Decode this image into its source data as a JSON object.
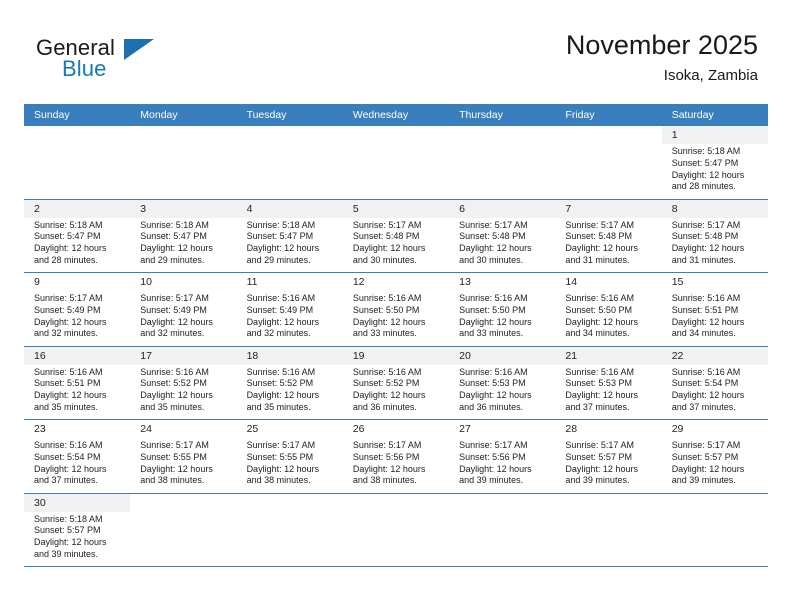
{
  "brand": {
    "name_primary": "General",
    "name_secondary": "Blue",
    "flag_icon": "blue-triangle-flag-icon",
    "accent_color": "#1878be"
  },
  "header": {
    "title": "November 2025",
    "subtitle": "Isoka, Zambia",
    "header_bg_color": "#3a7fbd"
  },
  "weekdays": [
    "Sunday",
    "Monday",
    "Tuesday",
    "Wednesday",
    "Thursday",
    "Friday",
    "Saturday"
  ],
  "labels": {
    "sunrise_prefix": "Sunrise:",
    "sunset_prefix": "Sunset:",
    "daylight_prefix": "Daylight:"
  },
  "weeks": [
    {
      "shaded": true,
      "days": [
        {
          "empty": true
        },
        {
          "empty": true
        },
        {
          "empty": true
        },
        {
          "empty": true
        },
        {
          "empty": true
        },
        {
          "empty": true
        },
        {
          "date": "1",
          "sunrise": "Sunrise: 5:18 AM",
          "sunset": "Sunset: 5:47 PM",
          "daylight_line1": "Daylight: 12 hours",
          "daylight_line2": "and 28 minutes."
        }
      ]
    },
    {
      "shaded": true,
      "days": [
        {
          "date": "2",
          "sunrise": "Sunrise: 5:18 AM",
          "sunset": "Sunset: 5:47 PM",
          "daylight_line1": "Daylight: 12 hours",
          "daylight_line2": "and 28 minutes."
        },
        {
          "date": "3",
          "sunrise": "Sunrise: 5:18 AM",
          "sunset": "Sunset: 5:47 PM",
          "daylight_line1": "Daylight: 12 hours",
          "daylight_line2": "and 29 minutes."
        },
        {
          "date": "4",
          "sunrise": "Sunrise: 5:18 AM",
          "sunset": "Sunset: 5:47 PM",
          "daylight_line1": "Daylight: 12 hours",
          "daylight_line2": "and 29 minutes."
        },
        {
          "date": "5",
          "sunrise": "Sunrise: 5:17 AM",
          "sunset": "Sunset: 5:48 PM",
          "daylight_line1": "Daylight: 12 hours",
          "daylight_line2": "and 30 minutes."
        },
        {
          "date": "6",
          "sunrise": "Sunrise: 5:17 AM",
          "sunset": "Sunset: 5:48 PM",
          "daylight_line1": "Daylight: 12 hours",
          "daylight_line2": "and 30 minutes."
        },
        {
          "date": "7",
          "sunrise": "Sunrise: 5:17 AM",
          "sunset": "Sunset: 5:48 PM",
          "daylight_line1": "Daylight: 12 hours",
          "daylight_line2": "and 31 minutes."
        },
        {
          "date": "8",
          "sunrise": "Sunrise: 5:17 AM",
          "sunset": "Sunset: 5:48 PM",
          "daylight_line1": "Daylight: 12 hours",
          "daylight_line2": "and 31 minutes."
        }
      ]
    },
    {
      "shaded": false,
      "days": [
        {
          "date": "9",
          "sunrise": "Sunrise: 5:17 AM",
          "sunset": "Sunset: 5:49 PM",
          "daylight_line1": "Daylight: 12 hours",
          "daylight_line2": "and 32 minutes."
        },
        {
          "date": "10",
          "sunrise": "Sunrise: 5:17 AM",
          "sunset": "Sunset: 5:49 PM",
          "daylight_line1": "Daylight: 12 hours",
          "daylight_line2": "and 32 minutes."
        },
        {
          "date": "11",
          "sunrise": "Sunrise: 5:16 AM",
          "sunset": "Sunset: 5:49 PM",
          "daylight_line1": "Daylight: 12 hours",
          "daylight_line2": "and 32 minutes."
        },
        {
          "date": "12",
          "sunrise": "Sunrise: 5:16 AM",
          "sunset": "Sunset: 5:50 PM",
          "daylight_line1": "Daylight: 12 hours",
          "daylight_line2": "and 33 minutes."
        },
        {
          "date": "13",
          "sunrise": "Sunrise: 5:16 AM",
          "sunset": "Sunset: 5:50 PM",
          "daylight_line1": "Daylight: 12 hours",
          "daylight_line2": "and 33 minutes."
        },
        {
          "date": "14",
          "sunrise": "Sunrise: 5:16 AM",
          "sunset": "Sunset: 5:50 PM",
          "daylight_line1": "Daylight: 12 hours",
          "daylight_line2": "and 34 minutes."
        },
        {
          "date": "15",
          "sunrise": "Sunrise: 5:16 AM",
          "sunset": "Sunset: 5:51 PM",
          "daylight_line1": "Daylight: 12 hours",
          "daylight_line2": "and 34 minutes."
        }
      ]
    },
    {
      "shaded": true,
      "days": [
        {
          "date": "16",
          "sunrise": "Sunrise: 5:16 AM",
          "sunset": "Sunset: 5:51 PM",
          "daylight_line1": "Daylight: 12 hours",
          "daylight_line2": "and 35 minutes."
        },
        {
          "date": "17",
          "sunrise": "Sunrise: 5:16 AM",
          "sunset": "Sunset: 5:52 PM",
          "daylight_line1": "Daylight: 12 hours",
          "daylight_line2": "and 35 minutes."
        },
        {
          "date": "18",
          "sunrise": "Sunrise: 5:16 AM",
          "sunset": "Sunset: 5:52 PM",
          "daylight_line1": "Daylight: 12 hours",
          "daylight_line2": "and 35 minutes."
        },
        {
          "date": "19",
          "sunrise": "Sunrise: 5:16 AM",
          "sunset": "Sunset: 5:52 PM",
          "daylight_line1": "Daylight: 12 hours",
          "daylight_line2": "and 36 minutes."
        },
        {
          "date": "20",
          "sunrise": "Sunrise: 5:16 AM",
          "sunset": "Sunset: 5:53 PM",
          "daylight_line1": "Daylight: 12 hours",
          "daylight_line2": "and 36 minutes."
        },
        {
          "date": "21",
          "sunrise": "Sunrise: 5:16 AM",
          "sunset": "Sunset: 5:53 PM",
          "daylight_line1": "Daylight: 12 hours",
          "daylight_line2": "and 37 minutes."
        },
        {
          "date": "22",
          "sunrise": "Sunrise: 5:16 AM",
          "sunset": "Sunset: 5:54 PM",
          "daylight_line1": "Daylight: 12 hours",
          "daylight_line2": "and 37 minutes."
        }
      ]
    },
    {
      "shaded": false,
      "days": [
        {
          "date": "23",
          "sunrise": "Sunrise: 5:16 AM",
          "sunset": "Sunset: 5:54 PM",
          "daylight_line1": "Daylight: 12 hours",
          "daylight_line2": "and 37 minutes."
        },
        {
          "date": "24",
          "sunrise": "Sunrise: 5:17 AM",
          "sunset": "Sunset: 5:55 PM",
          "daylight_line1": "Daylight: 12 hours",
          "daylight_line2": "and 38 minutes."
        },
        {
          "date": "25",
          "sunrise": "Sunrise: 5:17 AM",
          "sunset": "Sunset: 5:55 PM",
          "daylight_line1": "Daylight: 12 hours",
          "daylight_line2": "and 38 minutes."
        },
        {
          "date": "26",
          "sunrise": "Sunrise: 5:17 AM",
          "sunset": "Sunset: 5:56 PM",
          "daylight_line1": "Daylight: 12 hours",
          "daylight_line2": "and 38 minutes."
        },
        {
          "date": "27",
          "sunrise": "Sunrise: 5:17 AM",
          "sunset": "Sunset: 5:56 PM",
          "daylight_line1": "Daylight: 12 hours",
          "daylight_line2": "and 39 minutes."
        },
        {
          "date": "28",
          "sunrise": "Sunrise: 5:17 AM",
          "sunset": "Sunset: 5:57 PM",
          "daylight_line1": "Daylight: 12 hours",
          "daylight_line2": "and 39 minutes."
        },
        {
          "date": "29",
          "sunrise": "Sunrise: 5:17 AM",
          "sunset": "Sunset: 5:57 PM",
          "daylight_line1": "Daylight: 12 hours",
          "daylight_line2": "and 39 minutes."
        }
      ]
    },
    {
      "shaded": true,
      "days": [
        {
          "date": "30",
          "sunrise": "Sunrise: 5:18 AM",
          "sunset": "Sunset: 5:57 PM",
          "daylight_line1": "Daylight: 12 hours",
          "daylight_line2": "and 39 minutes."
        },
        {
          "empty": true
        },
        {
          "empty": true
        },
        {
          "empty": true
        },
        {
          "empty": true
        },
        {
          "empty": true
        },
        {
          "empty": true
        }
      ]
    }
  ]
}
